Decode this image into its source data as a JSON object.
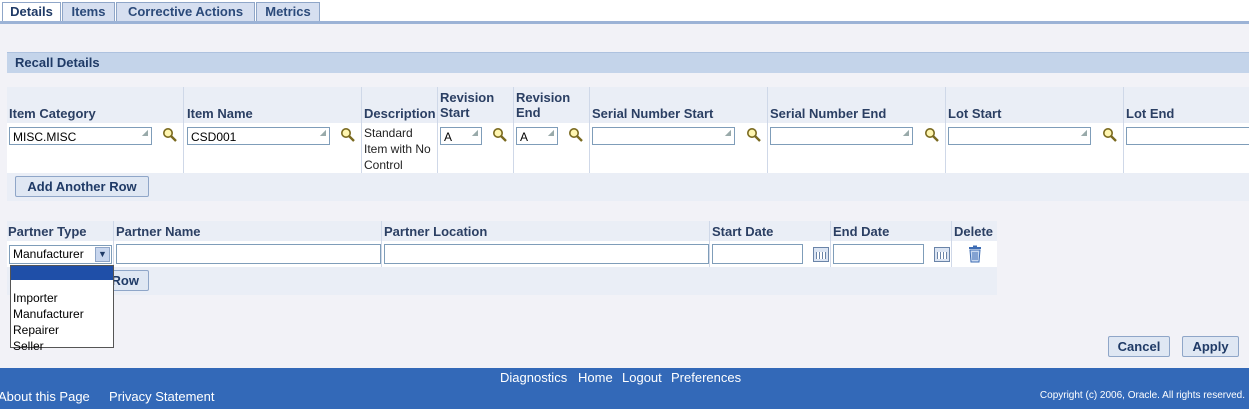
{
  "tabs": [
    "Details",
    "Items",
    "Corrective Actions",
    "Metrics"
  ],
  "section_title": "Recall Details",
  "grid": {
    "headers": {
      "item_category": "Item Category",
      "item_name": "Item Name",
      "description": "Description",
      "revision_start_1": "Revision",
      "revision_start_2": "Start",
      "revision_end_1": "Revision",
      "revision_end_2": "End",
      "serial_start": "Serial Number Start",
      "serial_end": "Serial Number End",
      "lot_start": "Lot Start",
      "lot_end": "Lot End"
    },
    "row": {
      "item_category": "MISC.MISC",
      "item_name": "CSD001",
      "description_lines": [
        "Standard",
        "Item with No",
        "Control"
      ],
      "revision_start": "A",
      "revision_end": "A",
      "serial_start": "",
      "serial_end": "",
      "lot_start": "",
      "lot_end": ""
    },
    "add_row_label": "Add Another Row"
  },
  "partners": {
    "headers": {
      "partner_type": "Partner Type",
      "partner_name": "Partner Name",
      "partner_location": "Partner Location",
      "start_date": "Start Date",
      "end_date": "End Date",
      "delete": "Delete"
    },
    "row": {
      "partner_type": "Manufacturer",
      "partner_name": "",
      "partner_location": "",
      "start_date": "",
      "end_date": ""
    },
    "add_row_label_visible": "Row",
    "dropdown_options": [
      "",
      "Importer",
      "Manufacturer",
      "Repairer",
      "Seller"
    ]
  },
  "actions": {
    "cancel": "Cancel",
    "apply": "Apply"
  },
  "footer": {
    "links_top": [
      "Diagnostics",
      "Home",
      "Logout",
      "Preferences"
    ],
    "about": "About this Page",
    "privacy": "Privacy Statement",
    "copyright": "Copyright (c) 2006, Oracle. All rights reserved."
  },
  "colors": {
    "footer_bg": "#3369b8",
    "header_text": "#1f3a66",
    "selected_option": "#1f4fa8"
  },
  "icons": {
    "lookup": "magnifier-icon",
    "calendar": "calendar-icon",
    "delete": "trash-icon",
    "dropdown": "chevron-down-icon"
  }
}
